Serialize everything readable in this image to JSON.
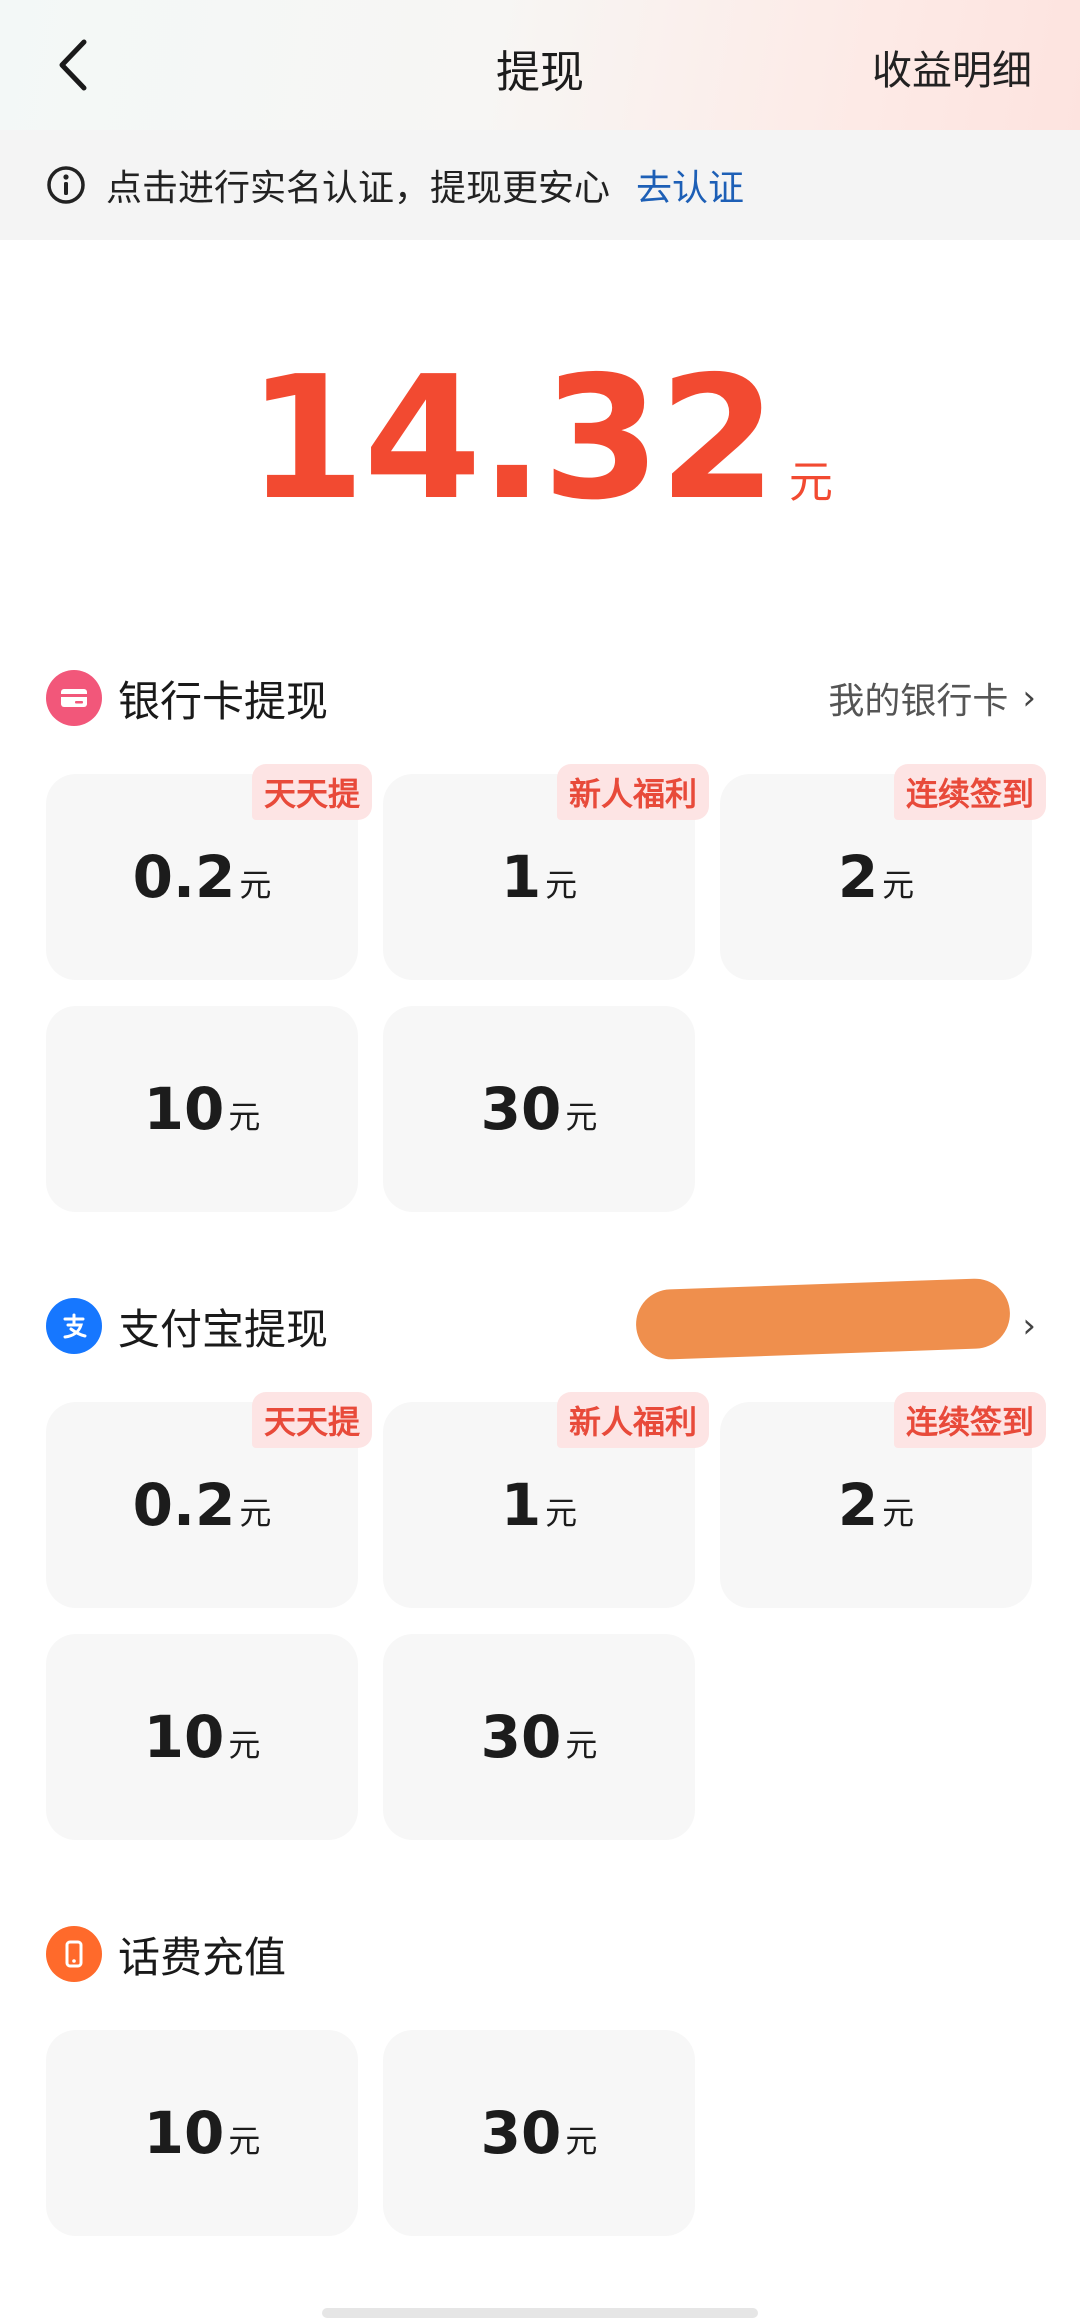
{
  "header": {
    "title": "提现",
    "detail_link": "收益明细"
  },
  "notice": {
    "text": "点击进行实名认证，提现更安心",
    "link": "去认证"
  },
  "balance": {
    "amount": "14.32",
    "unit": "元"
  },
  "sections": {
    "bank": {
      "title": "银行卡提现",
      "right_label": "我的银行卡",
      "icon_color": "#f2577a",
      "options": [
        {
          "amount": "0.2",
          "unit": "元",
          "tag": "天天提"
        },
        {
          "amount": "1",
          "unit": "元",
          "tag": "新人福利"
        },
        {
          "amount": "2",
          "unit": "元",
          "tag": "连续签到"
        },
        {
          "amount": "10",
          "unit": "元"
        },
        {
          "amount": "30",
          "unit": "元"
        }
      ]
    },
    "alipay": {
      "title": "支付宝提现",
      "icon_color": "#1677ff",
      "options": [
        {
          "amount": "0.2",
          "unit": "元",
          "tag": "天天提"
        },
        {
          "amount": "1",
          "unit": "元",
          "tag": "新人福利"
        },
        {
          "amount": "2",
          "unit": "元",
          "tag": "连续签到"
        },
        {
          "amount": "10",
          "unit": "元"
        },
        {
          "amount": "30",
          "unit": "元"
        }
      ]
    },
    "phone": {
      "title": "话费充值",
      "icon_color": "#ff6a2b",
      "options": [
        {
          "amount": "10",
          "unit": "元"
        },
        {
          "amount": "30",
          "unit": "元"
        }
      ]
    }
  }
}
